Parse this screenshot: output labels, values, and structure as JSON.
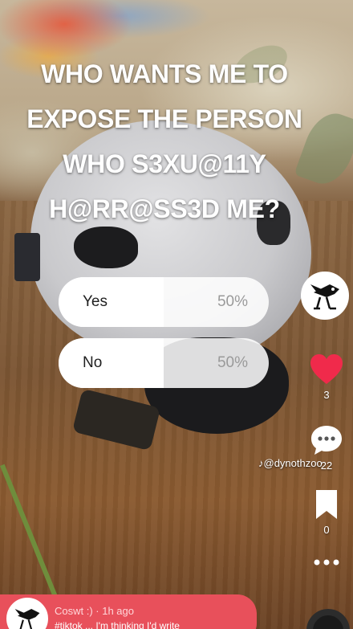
{
  "question": {
    "lines": [
      "WHO WANTS ME TO",
      "EXPOSE THE PERSON",
      "WHO S3XU@11Y",
      "H@RR@SS3D ME?"
    ]
  },
  "poll": {
    "options": [
      {
        "label": "Yes",
        "percent_text": "50%",
        "fraction": 0.5
      },
      {
        "label": "No",
        "percent_text": "50%",
        "fraction": 0.5
      }
    ]
  },
  "actions": {
    "like_count": "3",
    "comment_count": "22",
    "save_count": "0"
  },
  "watermark": {
    "handle": "@dynoth",
    "handle_tail": "zoo"
  },
  "comment": {
    "user": "Coswt :)",
    "time": "1h ago",
    "text": "#tiktok ... I'm thinking I'd write"
  },
  "colors": {
    "like_heart": "#f02a4b",
    "comment_card": "#e8505b"
  },
  "icons": [
    "heart-icon",
    "comment-bubble-icon",
    "bookmark-icon",
    "more-dots-icon",
    "tiktok-logo-icon"
  ]
}
